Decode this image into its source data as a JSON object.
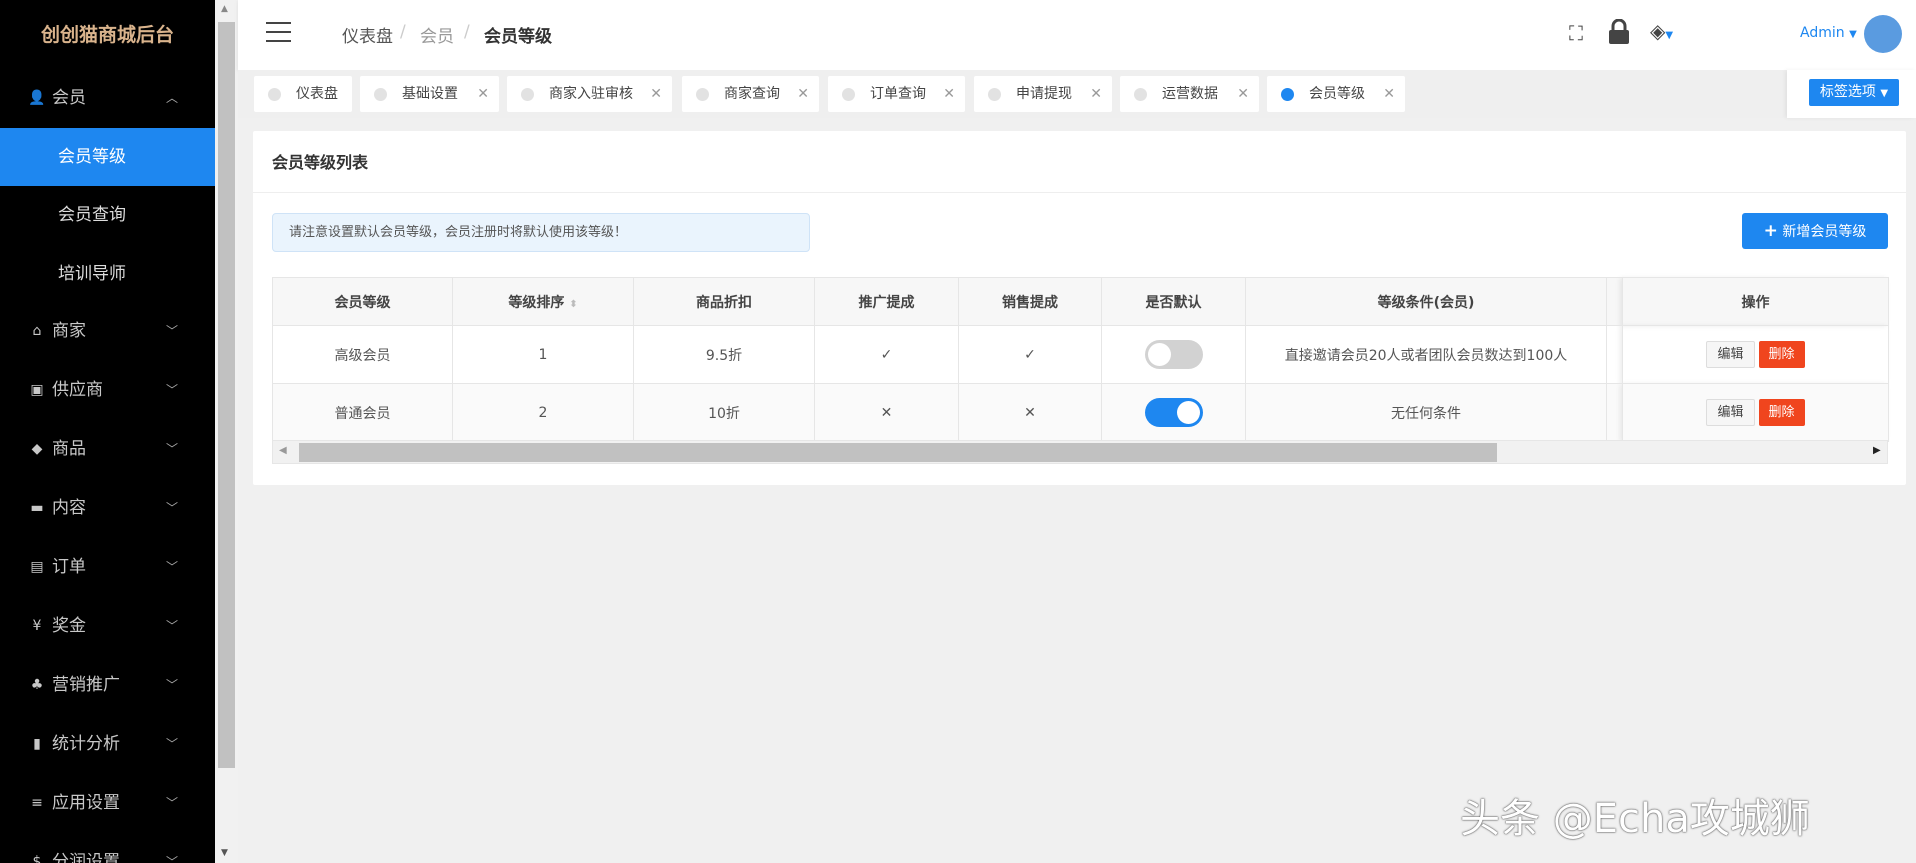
{
  "app": {
    "title": "创创猫商城后台"
  },
  "sidebar": {
    "items": [
      {
        "label": "会员",
        "icon": "user-icon",
        "expanded": true,
        "children": [
          {
            "label": "会员等级",
            "active": true
          },
          {
            "label": "会员查询"
          },
          {
            "label": "培训导师"
          }
        ]
      },
      {
        "label": "商家",
        "icon": "home-icon"
      },
      {
        "label": "供应商",
        "icon": "plug-icon"
      },
      {
        "label": "商品",
        "icon": "tag-icon"
      },
      {
        "label": "内容",
        "icon": "folder-icon"
      },
      {
        "label": "订单",
        "icon": "list-icon"
      },
      {
        "label": "奖金",
        "icon": "yen-icon"
      },
      {
        "label": "营销推广",
        "icon": "playstation-icon"
      },
      {
        "label": "统计分析",
        "icon": "bar-chart-icon"
      },
      {
        "label": "应用设置",
        "icon": "bars-icon"
      },
      {
        "label": "分润设置",
        "icon": "dollar-icon"
      }
    ]
  },
  "header": {
    "breadcrumb": [
      "仪表盘",
      "会员",
      "会员等级"
    ],
    "user": "Admin"
  },
  "tabs": [
    {
      "label": "仪表盘"
    },
    {
      "label": "基础设置"
    },
    {
      "label": "商家入驻审核"
    },
    {
      "label": "商家查询"
    },
    {
      "label": "订单查询"
    },
    {
      "label": "申请提现"
    },
    {
      "label": "运营数据"
    },
    {
      "label": "会员等级",
      "active": true
    }
  ],
  "tab_options": "标签选项",
  "card": {
    "title": "会员等级列表",
    "notice": "请注意设置默认会员等级，会员注册时将默认使用该等级！",
    "add_button": "新增会员等级"
  },
  "table": {
    "columns": [
      "会员等级",
      "等级排序",
      "商品折扣",
      "推广提成",
      "销售提成",
      "是否默认",
      "等级条件(会员)",
      "操作"
    ],
    "rows": [
      {
        "level": "高级会员",
        "sort": "1",
        "discount": "9.5折",
        "promo": "✓",
        "sales": "✓",
        "default": false,
        "condition": "直接邀请会员20人或者团队会员数达到100人"
      },
      {
        "level": "普通会员",
        "sort": "2",
        "discount": "10折",
        "promo": "✕",
        "sales": "✕",
        "default": true,
        "condition": "无任何条件"
      }
    ],
    "edit": "编辑",
    "delete": "删除"
  },
  "watermark": "头条 @Echa攻城狮",
  "colors": {
    "accent": "#1e87f0",
    "danger": "#f0451e",
    "logo": "#d9b38c"
  }
}
